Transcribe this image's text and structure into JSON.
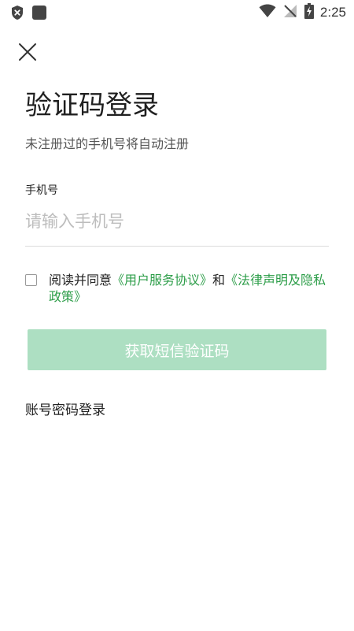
{
  "status_bar": {
    "time": "2:25",
    "icons": [
      "shield-x-icon",
      "app-square-icon",
      "wifi-icon",
      "signal-off-icon",
      "battery-charging-icon"
    ]
  },
  "close_icon": "close-icon",
  "page": {
    "title": "验证码登录",
    "subtitle": "未注册过的手机号将自动注册"
  },
  "phone": {
    "label": "手机号",
    "placeholder": "请输入手机号",
    "value": ""
  },
  "agreement": {
    "checked": false,
    "prefix": "阅读并同意",
    "user_agreement": "《用户服务协议》",
    "conjunction": "和",
    "legal_privacy": "《法律声明及隐私政策》"
  },
  "sms_button": {
    "label": "获取短信验证码",
    "enabled": false
  },
  "password_login": {
    "label": "账号密码登录"
  },
  "colors": {
    "accent": "#2e9e4a",
    "button_disabled": "#addfc2",
    "placeholder": "#bdbdbd"
  }
}
